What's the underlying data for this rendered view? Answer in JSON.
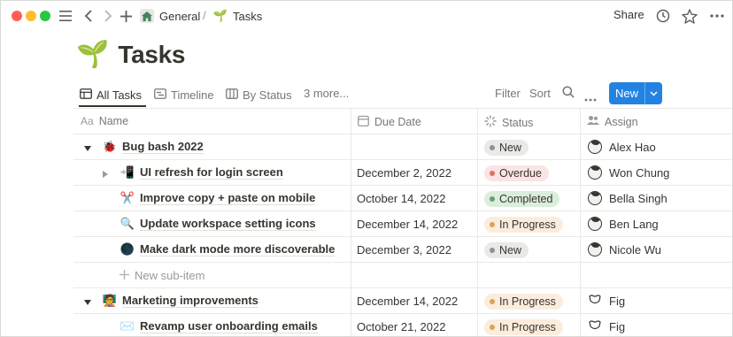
{
  "breadcrumb": {
    "workspace": "General",
    "sep": "/",
    "page": "Tasks"
  },
  "topbar": {
    "share_label": "Share"
  },
  "page": {
    "title": "Tasks"
  },
  "views": {
    "tabs": [
      {
        "label": "All Tasks",
        "icon": "table-icon"
      },
      {
        "label": "Timeline",
        "icon": "timeline-icon"
      },
      {
        "label": "By Status",
        "icon": "board-icon"
      }
    ],
    "more": "3 more...",
    "filter": "Filter",
    "sort": "Sort",
    "new_label": "New"
  },
  "table": {
    "columns": [
      {
        "label": "Name",
        "prefix": "Aa"
      },
      {
        "label": "Due Date",
        "icon": "calendar-icon"
      },
      {
        "label": "Status",
        "icon": "status-icon"
      },
      {
        "label": "Assign",
        "icon": "people-icon"
      }
    ],
    "rows": [
      {
        "name": "Bug bash 2022",
        "emoji": "🐞",
        "due": "",
        "status": "New",
        "assign": "Alex Hao",
        "level": 0,
        "toggle": "open"
      },
      {
        "name": "UI refresh for login screen",
        "emoji": "📲",
        "due": "December 2, 2022",
        "status": "Overdue",
        "assign": "Won Chung",
        "level": 1,
        "toggle": "closed"
      },
      {
        "name": "Improve copy + paste on mobile",
        "emoji": "✂️",
        "due": "October 14, 2022",
        "status": "Completed",
        "assign": "Bella Singh",
        "level": 1,
        "toggle": "none"
      },
      {
        "name": "Update workspace setting icons",
        "emoji": "🔍",
        "due": "December 14, 2022",
        "status": "In Progress",
        "assign": "Ben Lang",
        "level": 1,
        "toggle": "none"
      },
      {
        "name": "Make dark mode more discoverable",
        "emoji": "🌑",
        "due": "December 3, 2022",
        "status": "New",
        "assign": "Nicole Wu",
        "level": 1,
        "toggle": "none"
      },
      {
        "name": "Marketing improvements",
        "emoji": "🧑‍🏫",
        "due": "December 14, 2022",
        "status": "In Progress",
        "assign": "Fig",
        "level": 0,
        "toggle": "open"
      },
      {
        "name": "Revamp user onboarding emails",
        "emoji": "✉️",
        "due": "October 21, 2022",
        "status": "In Progress",
        "assign": "Fig",
        "level": 1,
        "toggle": "none"
      }
    ],
    "new_sub_item": "New sub-item"
  },
  "colors": {
    "new_pill": "#e9e9e7",
    "new_dot": "#91918e",
    "overdue_pill": "#fbe4e4",
    "overdue_dot": "#e16f64",
    "completed_pill": "#dbeddb",
    "completed_dot": "#6c9b7d",
    "inprogress_pill": "#fbecdd",
    "inprogress_dot": "#d9a453",
    "accent": "#2383e2"
  }
}
